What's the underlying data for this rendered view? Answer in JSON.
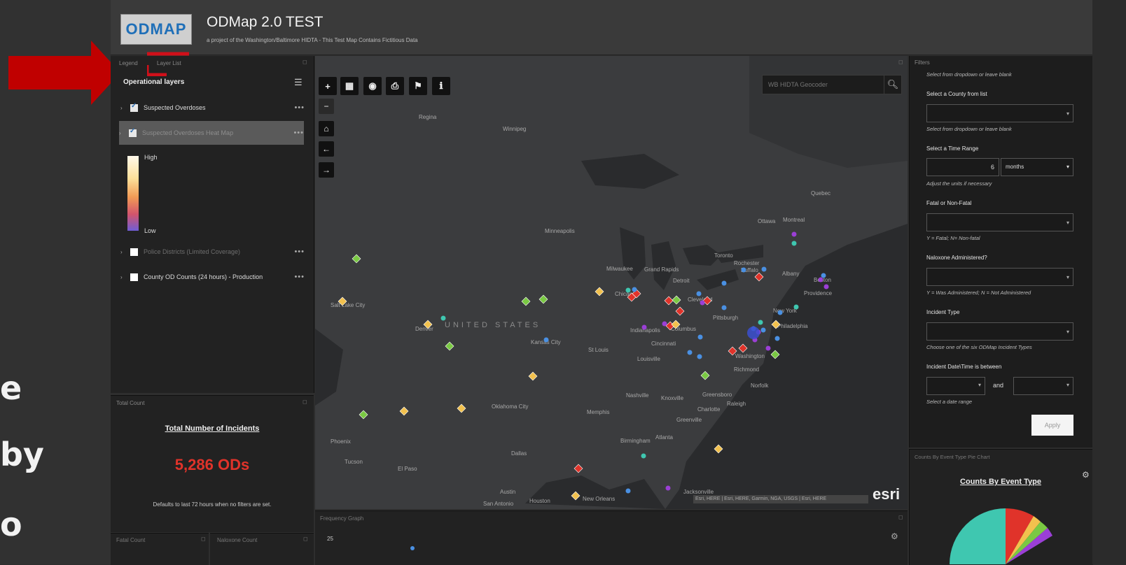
{
  "slide": {
    "words": [
      "e",
      "by",
      "o"
    ]
  },
  "header": {
    "logo_text": "ODMAP",
    "title": "ODMap 2.0 TEST",
    "subtitle": "a project of the Washington/Baltimore HIDTA - This Test Map Contains Fictitious Data"
  },
  "left_panel": {
    "tabs": [
      "Legend",
      "Layer List"
    ],
    "operational_layers_label": "Operational layers",
    "layers": [
      {
        "label": "Suspected Overdoses",
        "checked": true
      },
      {
        "label": "Suspected Overdoses Heat Map",
        "checked": true
      },
      {
        "label": "Police Districts (Limited Coverage)",
        "checked": false
      },
      {
        "label": "County OD Counts (24 hours) - Production",
        "checked": false
      }
    ],
    "legend_high": "High",
    "legend_low": "Low",
    "more_glyph": "•••"
  },
  "total_count": {
    "panel_title": "Total Count",
    "heading": "Total Number of Incidents",
    "value": "5,286 ODs",
    "note": "Defaults to last 72 hours when no filters are set."
  },
  "bottom_left": {
    "fatal_title": "Fatal Count",
    "naloxone_title": "Naloxone Count"
  },
  "map": {
    "geocoder_placeholder": "WB HIDTA Geocoder",
    "country_label": "UNITED STATES",
    "attribution": "Esri, HERE | Esri, HERE, Garmin, NGA, USGS | Esri, HERE",
    "esri_logo": "esri",
    "toolbar_icons": [
      "zoom-in-icon",
      "basemap-gallery-icon",
      "layers-icon",
      "print-icon",
      "measure-icon",
      "info-icon"
    ],
    "cities": [
      {
        "name": "Regina"
      },
      {
        "name": "Winnipeg"
      },
      {
        "name": "Quebec"
      },
      {
        "name": "Ottawa"
      },
      {
        "name": "Montreal"
      },
      {
        "name": "Minneapolis"
      },
      {
        "name": "Toronto"
      },
      {
        "name": "Rochester"
      },
      {
        "name": "Buffalo"
      },
      {
        "name": "Albany"
      },
      {
        "name": "Milwaukee"
      },
      {
        "name": "Grand Rapids"
      },
      {
        "name": "Detroit"
      },
      {
        "name": "Chicago"
      },
      {
        "name": "Cleveland"
      },
      {
        "name": "Boston"
      },
      {
        "name": "Providence"
      },
      {
        "name": "New York"
      },
      {
        "name": "Philadelphia"
      },
      {
        "name": "Pittsburgh"
      },
      {
        "name": "Salt Lake City"
      },
      {
        "name": "Denver"
      },
      {
        "name": "Kansas City"
      },
      {
        "name": "St Louis"
      },
      {
        "name": "Indianapolis"
      },
      {
        "name": "Cincinnati"
      },
      {
        "name": "Columbus"
      },
      {
        "name": "Louisville"
      },
      {
        "name": "Washington"
      },
      {
        "name": "Richmond"
      },
      {
        "name": "Norfolk"
      },
      {
        "name": "Nashville"
      },
      {
        "name": "Knoxville"
      },
      {
        "name": "Greensboro"
      },
      {
        "name": "Raleigh"
      },
      {
        "name": "Charlotte"
      },
      {
        "name": "Greenville"
      },
      {
        "name": "Oklahoma City"
      },
      {
        "name": "Memphis"
      },
      {
        "name": "Birmingham"
      },
      {
        "name": "Atlanta"
      },
      {
        "name": "Phoenix"
      },
      {
        "name": "Tucson"
      },
      {
        "name": "El Paso"
      },
      {
        "name": "Dallas"
      },
      {
        "name": "Austin"
      },
      {
        "name": "San Antonio"
      },
      {
        "name": "Houston"
      },
      {
        "name": "New Orleans"
      },
      {
        "name": "Jacksonville"
      }
    ],
    "marker_colors": {
      "green": "#7ac943",
      "yellow": "#f2c14e",
      "red": "#e0332a",
      "teal": "#3fc7b0",
      "purple": "#9b3fd6",
      "blue": "#4a90e2"
    }
  },
  "frequency_chart": {
    "title": "Frequency Graph",
    "tick_top": "25"
  },
  "filters": {
    "panel_title": "Filters",
    "hint_top": "Select from dropdown or leave blank",
    "county_label": "Select a County from list",
    "county_hint": "Select from dropdown or leave blank",
    "time_label": "Select a Time Range",
    "time_value": "6",
    "time_unit": "months",
    "time_hint": "Adjust the units if necessary",
    "fatal_label": "Fatal or Non-Fatal",
    "fatal_hint": "Y = Fatal; N= Non-fatal",
    "naloxone_label": "Naloxone Administered?",
    "naloxone_hint": "Y = Was Administered; N = Not Administered",
    "incident_label": "Incident Type",
    "incident_hint": "Choose one of the six ODMap Incident Types",
    "date_label": "Incident Date\\Time is between",
    "date_and": "and",
    "date_hint": "Select a date range",
    "apply_label": "Apply"
  },
  "pie": {
    "panel_title": "Counts By Event Type Pie Chart",
    "heading": "Counts By Event Type",
    "colors": [
      "#3fc7b0",
      "#e0332a",
      "#f2c14e",
      "#7ac943",
      "#9b3fd6"
    ]
  },
  "colors": {
    "accent_red": "#e0332a",
    "arrow_red": "#c00000"
  }
}
